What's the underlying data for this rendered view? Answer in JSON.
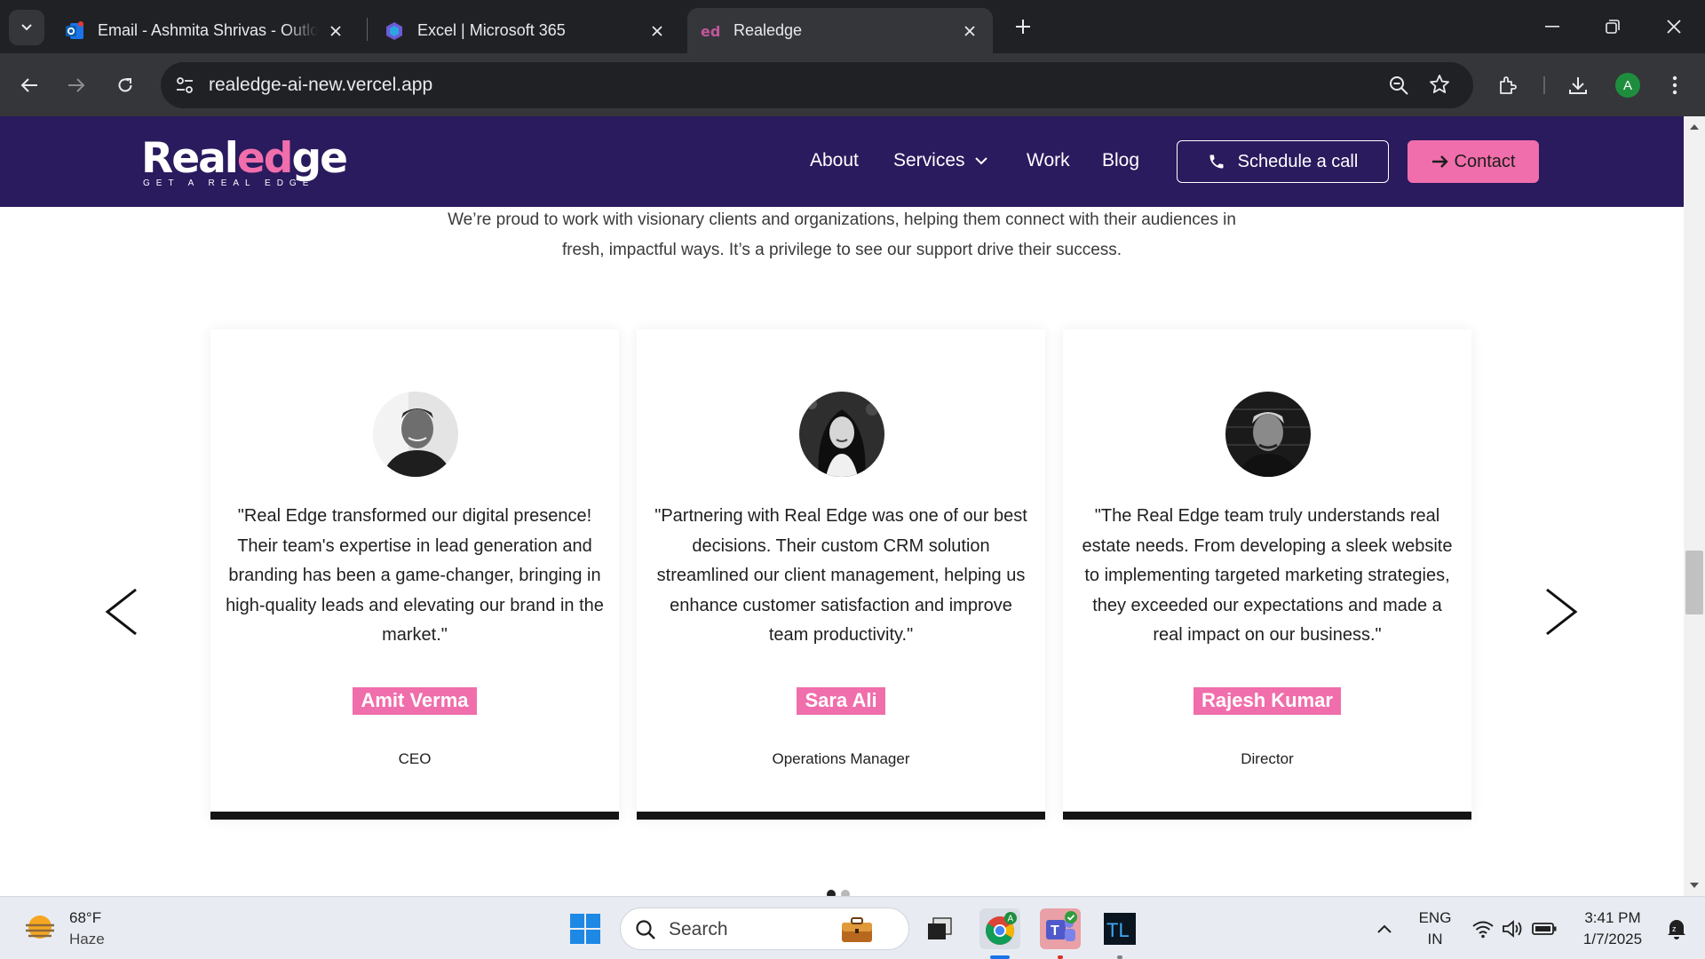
{
  "browser": {
    "tabs": [
      {
        "title": "Email - Ashmita Shrivas - Outlook",
        "active": false
      },
      {
        "title": "Excel | Microsoft 365",
        "active": false
      },
      {
        "title": "Realedge",
        "active": true
      }
    ],
    "url": "realedge-ai-new.vercel.app",
    "profile_initial": "A"
  },
  "site": {
    "logo": {
      "word_a": "Real",
      "word_e": "ed",
      "word_b": "ge",
      "tagline": "GET A REAL EDGE"
    },
    "nav": {
      "about": "About",
      "services": "Services",
      "work": "Work",
      "blog": "Blog",
      "schedule": "Schedule a call",
      "contact": "Contact"
    },
    "intro": "We’re proud to work with visionary clients and organizations, helping them connect with their audiences in fresh, impactful ways. It’s a privilege to see our support drive their success.",
    "testimonials": [
      {
        "quote": "\"Real Edge transformed our digital presence! Their team's expertise in lead generation and branding has been a game-changer, bringing in high-quality leads and elevating our brand in the market.\"",
        "name": "Amit Verma",
        "role": "CEO"
      },
      {
        "quote": "\"Partnering with Real Edge was one of our best decisions. Their custom CRM solution streamlined our client management, helping us enhance customer satisfaction and improve team productivity.\"",
        "name": "Sara Ali",
        "role": "Operations Manager"
      },
      {
        "quote": "\"The Real Edge team truly understands real estate needs. From developing a sleek website to implementing targeted marketing strategies, they exceeded our expectations and made a real impact on our business.\"",
        "name": "Rajesh Kumar",
        "role": "Director"
      }
    ],
    "carousel": {
      "dot_count": 2,
      "active_dot": 0
    }
  },
  "taskbar": {
    "weather": {
      "temp": "68°F",
      "condition": "Haze"
    },
    "search_label": "Search",
    "language": {
      "lang": "ENG",
      "region": "IN"
    },
    "clock": {
      "time": "3:41 PM",
      "date": "1/7/2025"
    }
  },
  "colors": {
    "nav_bg": "#2a1a5e",
    "accent_pink": "#f06eab",
    "card_bar": "#141414"
  }
}
